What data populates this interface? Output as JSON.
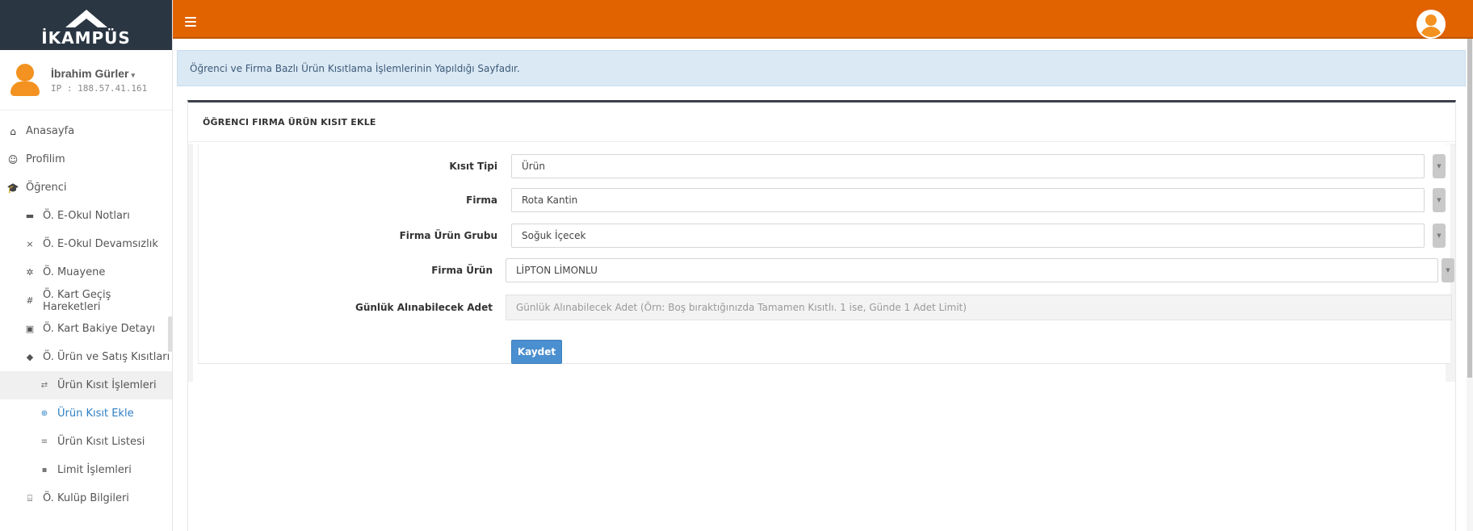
{
  "logo": {
    "text": "İKAMPÜS"
  },
  "user": {
    "name": "İbrahim Gürler",
    "caret": "▾",
    "ip": "IP : 188.57.41.161"
  },
  "menu": [
    {
      "label": "Anasayfa",
      "icon": "home-icon",
      "glyph": "⌂"
    },
    {
      "label": "Profilim",
      "icon": "smiley-icon",
      "glyph": "☺"
    },
    {
      "label": "Öğrenci",
      "icon": "graduation-cap-icon",
      "glyph": "🎓"
    },
    {
      "label": "Ö. E-Okul Notları",
      "icon": "list-icon",
      "glyph": "▬"
    },
    {
      "label": "Ö. E-Okul Devamsızlık",
      "icon": "times-icon",
      "glyph": "×"
    },
    {
      "label": "Ö. Muayene",
      "icon": "pills-icon",
      "glyph": "✲"
    },
    {
      "label": "Ö. Kart Geçiş Hareketleri",
      "icon": "hashtag-icon",
      "glyph": "#"
    },
    {
      "label": "Ö. Kart Bakiye Detayı",
      "icon": "wallet-icon",
      "glyph": "▣"
    },
    {
      "label": "Ö. Ürün ve Satış Kısıtları",
      "icon": "shield-icon",
      "glyph": "◆"
    },
    {
      "label": "Ürün Kısıt İşlemleri",
      "icon": "exchange-icon",
      "glyph": "⇄"
    },
    {
      "label": "Ürün Kısıt Ekle",
      "icon": "plus-circle-icon",
      "glyph": "⊕"
    },
    {
      "label": "Ürün Kısıt Listesi",
      "icon": "list-lines-icon",
      "glyph": "≡"
    },
    {
      "label": "Limit İşlemleri",
      "icon": "comment-icon",
      "glyph": "▪"
    },
    {
      "label": "Ö. Kulüp Bilgileri",
      "icon": "bank-icon",
      "glyph": "⌸"
    }
  ],
  "info": {
    "text": "Öğrenci ve Firma Bazlı Ürün Kısıtlama İşlemlerinin Yapıldığı Sayfadır."
  },
  "panel": {
    "title": "ÖĞRENCI FIRMA ÜRÜN KISIT EKLE"
  },
  "form": {
    "kisit_tipi": {
      "label": "Kısıt Tipi",
      "value": "Ürün"
    },
    "firma": {
      "label": "Firma",
      "value": "Rota Kantin"
    },
    "urun_grubu": {
      "label": "Firma Ürün Grubu",
      "value": "Soğuk İçecek"
    },
    "urun": {
      "label": "Firma Ürün",
      "value": "LİPTON LİMONLU"
    },
    "adet": {
      "label": "Günlük Alınabilecek Adet",
      "placeholder": "Günlük Alınabilecek Adet (Örn: Boş bıraktığınızda Tamamen Kısıtlı. 1 ise, Günde 1 Adet Limit)"
    },
    "save_label": "Kaydet",
    "arrow_glyph": "▼"
  },
  "colors": {
    "topbar": "#e06300",
    "logo_bg": "#2b3643",
    "accent": "#2f7fc4",
    "button": "#4a8fcf",
    "info_bg": "#dbe9f5"
  }
}
